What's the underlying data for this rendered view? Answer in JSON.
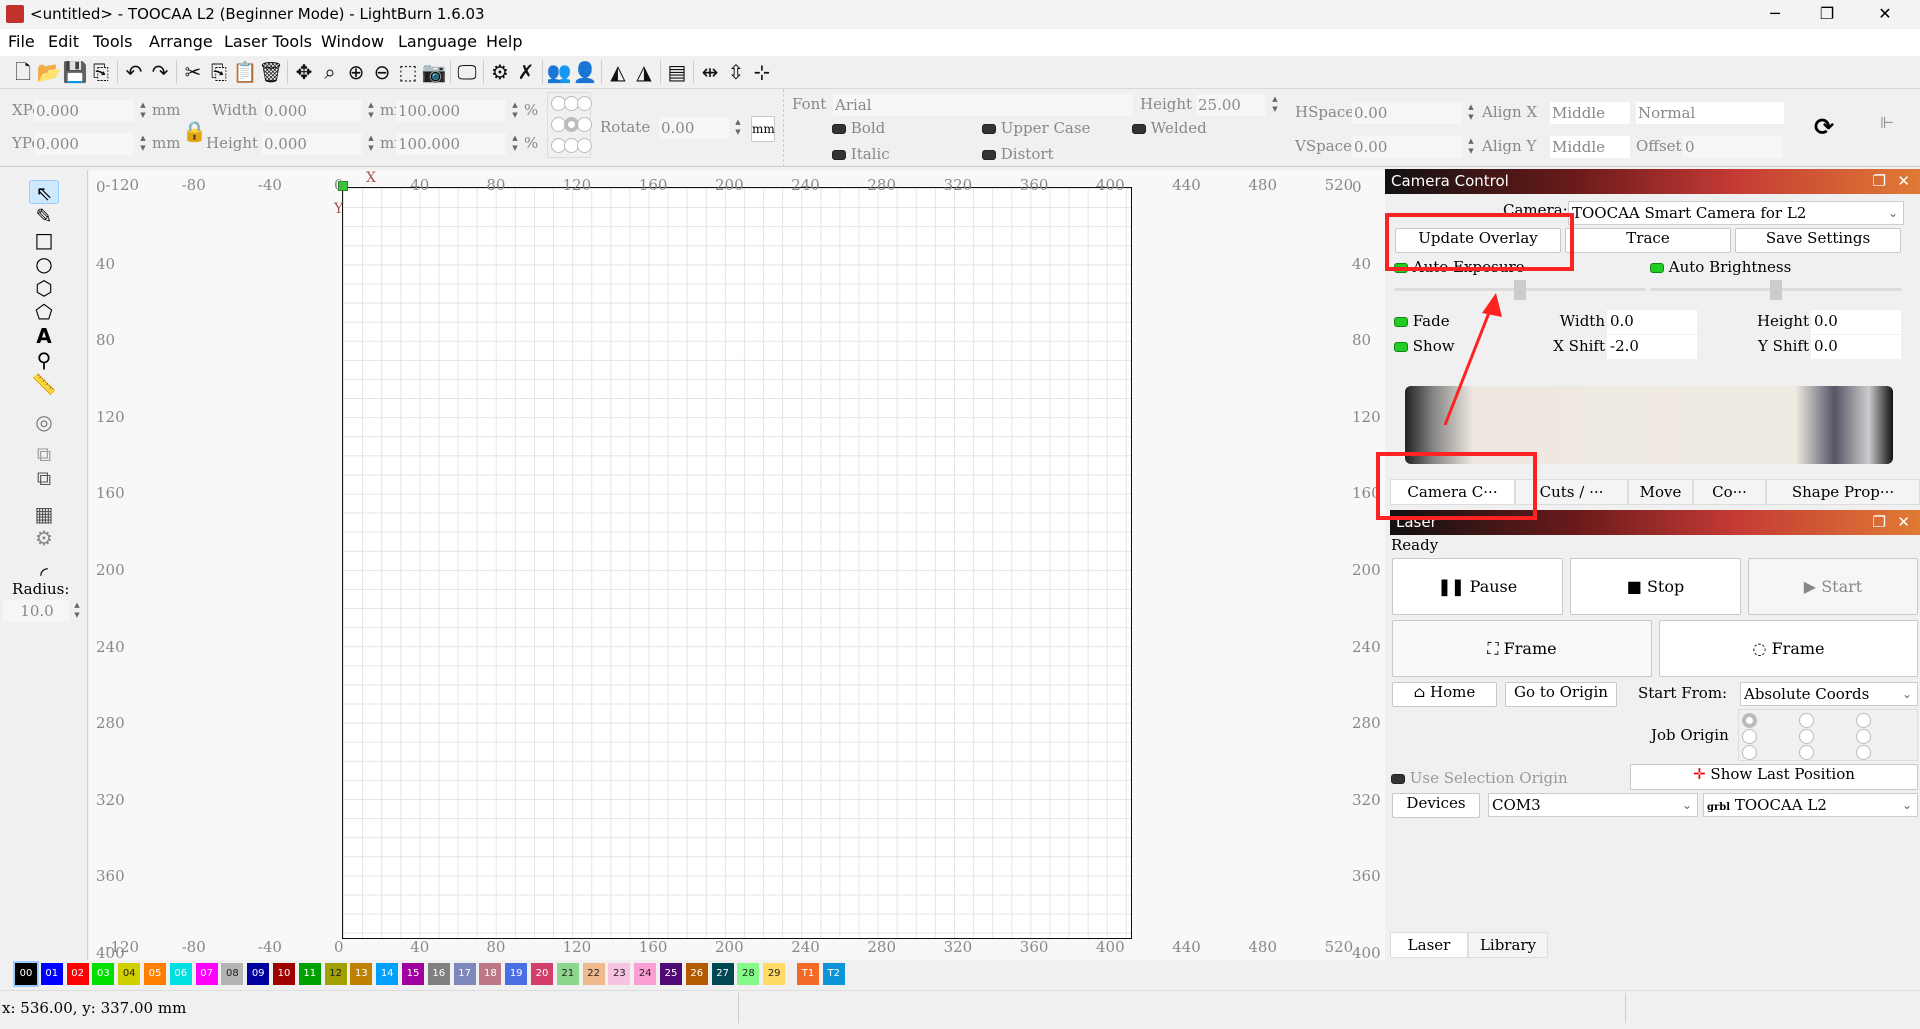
{
  "window": {
    "title": "<untitled> - TOOCAA L2 (Beginner Mode) - LightBurn 1.6.03",
    "minimize": "─",
    "maximize": "❐",
    "close": "✕"
  },
  "menu": [
    "File",
    "Edit",
    "Tools",
    "Arrange",
    "Laser Tools",
    "Window",
    "Language",
    "Help"
  ],
  "toolbar": {
    "icons": [
      "new-file",
      "open-folder",
      "save",
      "import",
      "sep",
      "undo",
      "redo",
      "sep",
      "cut",
      "copy",
      "paste",
      "delete",
      "sep",
      "move",
      "zoom-fit",
      "zoom-in",
      "zoom-out",
      "zoom-selection",
      "camera",
      "sep",
      "monitor",
      "sep",
      "settings",
      "tools",
      "sep",
      "group",
      "user",
      "sep",
      "mirror-h",
      "mirror-v",
      "sep",
      "align",
      "sep",
      "distribute-h",
      "distribute-v",
      "center"
    ]
  },
  "props": {
    "xpos_label": "XPos",
    "xpos": "0.000",
    "ypos_label": "YPos",
    "ypos": "0.000",
    "unit": "mm",
    "width_label": "Width",
    "width": "0.000",
    "height_label": "Height",
    "height": "0.000",
    "scale_w": "100.000",
    "scale_h": "100.000",
    "pct": "%",
    "rotate_label": "Rotate",
    "rotate": "0.00",
    "unit_button": "mm",
    "font_label": "Font",
    "font": "Arial",
    "text_height_label": "Height",
    "text_height": "25.00",
    "hspace_label": "HSpace",
    "hspace": "0.00",
    "vspace_label": "VSpace",
    "vspace": "0.00",
    "alignx_label": "Align X",
    "alignx": "Middle",
    "aligny_label": "Align Y",
    "aligny": "Middle",
    "mode": "Normal",
    "offset_label": "Offset",
    "offset": "0",
    "bold": "Bold",
    "italic": "Italic",
    "upper": "Upper Case",
    "distort": "Distort",
    "welded": "Welded"
  },
  "tools": {
    "radius_label": "Radius:",
    "radius": "10.0"
  },
  "ruler": {
    "x": [
      -120,
      -80,
      -40,
      0,
      40,
      80,
      120,
      160,
      200,
      240,
      280,
      320,
      360,
      400,
      440,
      480,
      520
    ],
    "y": [
      0,
      40,
      80,
      120,
      160,
      200,
      240,
      280,
      320,
      360,
      400
    ],
    "x_axis": "X",
    "y_axis": "Y"
  },
  "camera": {
    "title": "Camera Control",
    "camera_label": "Camera:",
    "camera": "TOOCAA Smart Camera for L2",
    "update_overlay": "Update Overlay",
    "trace": "Trace",
    "save_settings": "Save Settings",
    "auto_exposure": "Auto Exposure",
    "auto_brightness": "Auto Brightness",
    "exposure_level": 0.5,
    "brightness_level": 0.5,
    "fade": "Fade",
    "show": "Show",
    "width_label": "Width",
    "width": "0.0",
    "height_label": "Height",
    "height": "0.0",
    "xshift_label": "X Shift",
    "xshift": "-2.0",
    "yshift_label": "Y Shift",
    "yshift": "0.0",
    "tabs": [
      "Camera C···",
      "Cuts / ···",
      "Move",
      "Co···",
      "Shape Prop···"
    ]
  },
  "laser": {
    "title": "Laser",
    "status": "Ready",
    "pause": "Pause",
    "stop": "Stop",
    "start": "Start",
    "frame1": "Frame",
    "frame2": "Frame",
    "home": "Home",
    "go_origin": "Go to Origin",
    "start_from_label": "Start From:",
    "start_from": "Absolute Coords",
    "job_origin_label": "Job Origin",
    "use_selection": "Use Selection Origin",
    "show_last": "Show Last Position",
    "devices": "Devices",
    "port": "COM3",
    "device": "TOOCAA L2",
    "grbl": "grbl",
    "tabs": [
      "Laser",
      "Library"
    ]
  },
  "palette": [
    {
      "l": "00",
      "c": "#000000"
    },
    {
      "l": "01",
      "c": "#0000ff"
    },
    {
      "l": "02",
      "c": "#ff0000"
    },
    {
      "l": "03",
      "c": "#00e000"
    },
    {
      "l": "04",
      "c": "#d0d000"
    },
    {
      "l": "05",
      "c": "#ff8000"
    },
    {
      "l": "06",
      "c": "#00e0e0"
    },
    {
      "l": "07",
      "c": "#ff00ff"
    },
    {
      "l": "08",
      "c": "#b4b4b4"
    },
    {
      "l": "09",
      "c": "#0000a0"
    },
    {
      "l": "10",
      "c": "#a00000"
    },
    {
      "l": "11",
      "c": "#00a000"
    },
    {
      "l": "12",
      "c": "#a0a000"
    },
    {
      "l": "13",
      "c": "#c08000"
    },
    {
      "l": "14",
      "c": "#00a0ff"
    },
    {
      "l": "15",
      "c": "#a000a0"
    },
    {
      "l": "16",
      "c": "#808080"
    },
    {
      "l": "17",
      "c": "#7d87b9"
    },
    {
      "l": "18",
      "c": "#bb7784"
    },
    {
      "l": "19",
      "c": "#4a6fe3"
    },
    {
      "l": "20",
      "c": "#d33f6a"
    },
    {
      "l": "21",
      "c": "#8cd78c"
    },
    {
      "l": "22",
      "c": "#f0b98d"
    },
    {
      "l": "23",
      "c": "#f6c4e1"
    },
    {
      "l": "24",
      "c": "#fa9ed4"
    },
    {
      "l": "25",
      "c": "#500a78"
    },
    {
      "l": "26",
      "c": "#b45a00"
    },
    {
      "l": "27",
      "c": "#004754"
    },
    {
      "l": "28",
      "c": "#86fa88"
    },
    {
      "l": "29",
      "c": "#ffdb66"
    },
    {
      "l": "T1",
      "c": "#f36926"
    },
    {
      "l": "T2",
      "c": "#0c96d9"
    }
  ],
  "status": {
    "coords": "x: 536.00, y: 337.00 mm"
  },
  "annotation_color": "#ff2020"
}
